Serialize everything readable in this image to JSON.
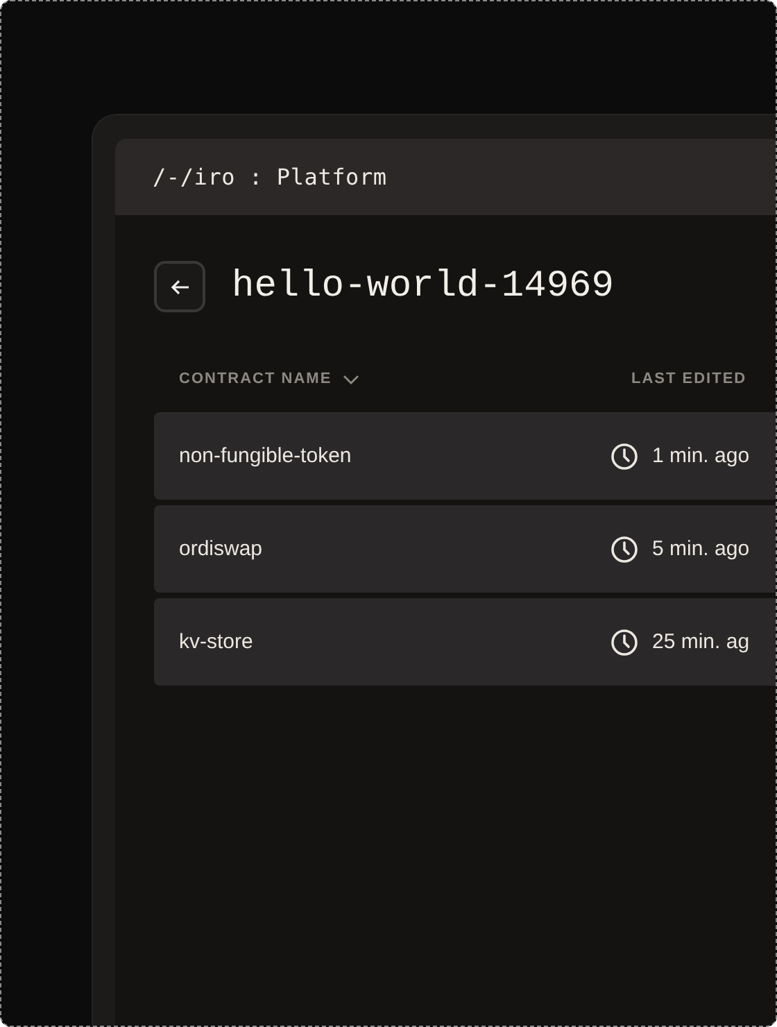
{
  "app_header": {
    "title": "/-/iro : Platform"
  },
  "page": {
    "title": "hello-world-14969"
  },
  "table": {
    "columns": [
      {
        "label": "CONTRACT NAME",
        "sorted": true
      },
      {
        "label": "LAST EDITED",
        "sorted": false
      }
    ],
    "rows": [
      {
        "name": "non-fungible-token",
        "last_edited": "1 min. ago"
      },
      {
        "name": "ordiswap",
        "last_edited": "5 min. ago"
      },
      {
        "name": "kv-store",
        "last_edited": "25 min. ag"
      }
    ]
  }
}
